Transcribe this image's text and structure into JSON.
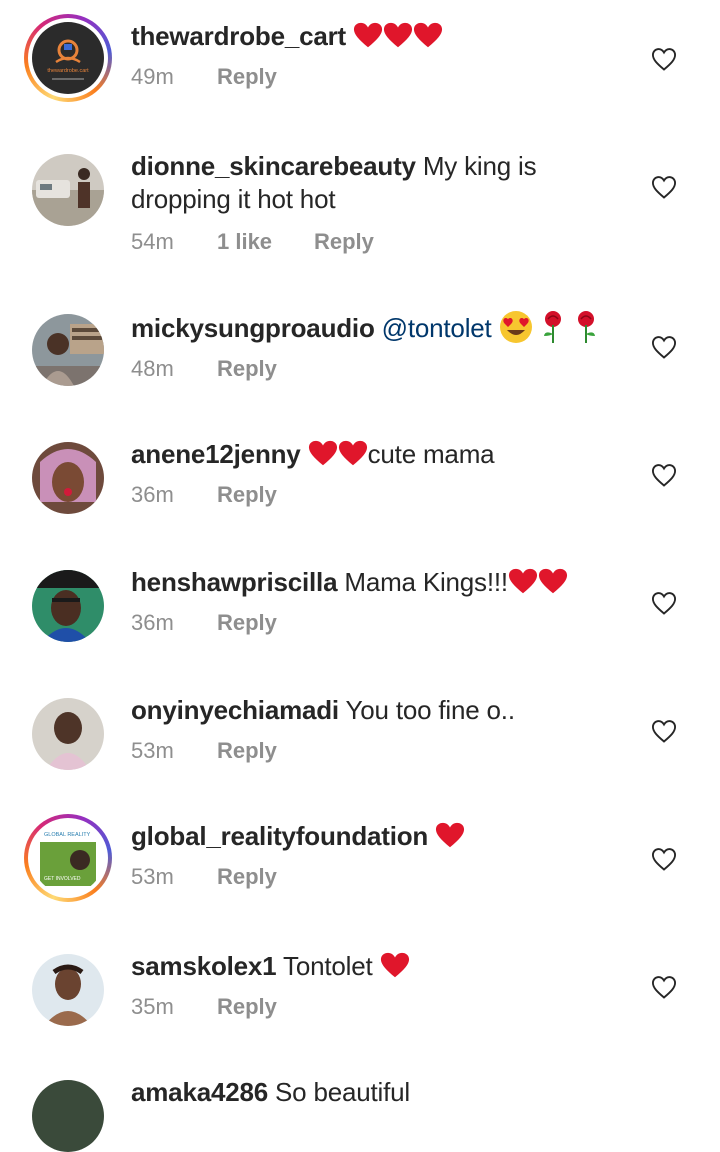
{
  "comments": [
    {
      "username": "thewardrobe_cart",
      "text": "",
      "time": "49m",
      "likes": "",
      "reply": "Reply",
      "story_ring": true,
      "avatar": {
        "bg": "#2b2b2b",
        "fg": "#e8833a",
        "logo_text": "thewardrobe.cart"
      }
    },
    {
      "username": "dionne_skincarebeauty",
      "text": "My king is dropping it hot hot",
      "time": "54m",
      "likes": "1 like",
      "reply": "Reply",
      "story_ring": false,
      "avatar": {
        "bg": "#b8b2a8",
        "fg": "#6e6a62"
      }
    },
    {
      "username": "mickysungproaudio",
      "text": "@tontolet",
      "time": "48m",
      "likes": "",
      "reply": "Reply",
      "story_ring": false,
      "avatar": {
        "bg": "#7d8a92",
        "fg": "#3d3a36"
      }
    },
    {
      "username": "anene12jenny",
      "text": "cute mama",
      "time": "36m",
      "likes": "",
      "reply": "Reply",
      "story_ring": false,
      "avatar": {
        "bg": "#8a5a4a",
        "fg": "#c98fb5"
      }
    },
    {
      "username": "henshawpriscilla",
      "text": "Mama Kings!!!",
      "time": "36m",
      "likes": "",
      "reply": "Reply",
      "story_ring": false,
      "avatar": {
        "bg": "#2e8c6a",
        "fg": "#1c1c1c"
      }
    },
    {
      "username": "onyinyechiamadi",
      "text": "You too fine o..",
      "time": "53m",
      "likes": "",
      "reply": "Reply",
      "story_ring": false,
      "avatar": {
        "bg": "#c9c4bc",
        "fg": "#4a3a30"
      }
    },
    {
      "username": "global_realityfoundation",
      "text": "",
      "time": "53m",
      "likes": "",
      "reply": "Reply",
      "story_ring": true,
      "avatar": {
        "bg": "#6aa03a",
        "fg": "#ffffff",
        "logo_text": "GLOBAL REALITY",
        "caption": "GET INVOLVED"
      }
    },
    {
      "username": "samskolex1",
      "text": "Tontolet",
      "time": "35m",
      "likes": "",
      "reply": "Reply",
      "story_ring": false,
      "avatar": {
        "bg": "#d9e6ee",
        "fg": "#5a3a28"
      }
    },
    {
      "username": "amaka4286",
      "text": "So beautiful",
      "time": "",
      "likes": "",
      "reply": "",
      "story_ring": false,
      "avatar": {
        "bg": "#3a4a3a",
        "fg": "#3a4a3a"
      }
    }
  ],
  "colors": {
    "heart": "#e0162b",
    "secondary_text": "#8e8e8e",
    "mention": "#00376b",
    "like_icon": "#262626"
  }
}
